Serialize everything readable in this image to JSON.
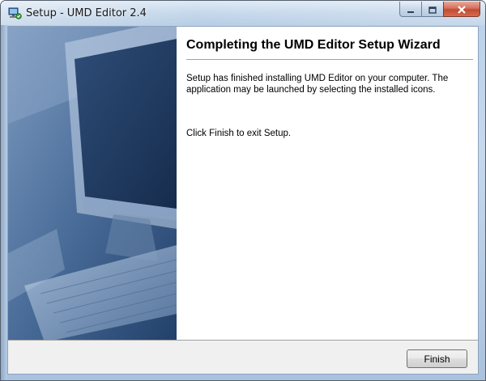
{
  "window": {
    "title": "Setup - UMD Editor 2.4",
    "icons": {
      "app": "setup-computer-icon",
      "minimize": "minimize-icon",
      "maximize": "maximize-icon",
      "close": "close-icon"
    }
  },
  "wizard": {
    "heading": "Completing the UMD Editor Setup Wizard",
    "paragraph1": "Setup has finished installing UMD Editor on your computer. The application may be launched by selecting the installed icons.",
    "paragraph2": "Click Finish to exit Setup.",
    "side_image": "wizard-computer-artwork"
  },
  "buttons": {
    "finish_label": "Finish"
  },
  "colors": {
    "titlebar": "#c3d6ea",
    "close_button": "#c24b33",
    "side_panel": "#3c5f8c",
    "footer": "#f0f0f0"
  }
}
